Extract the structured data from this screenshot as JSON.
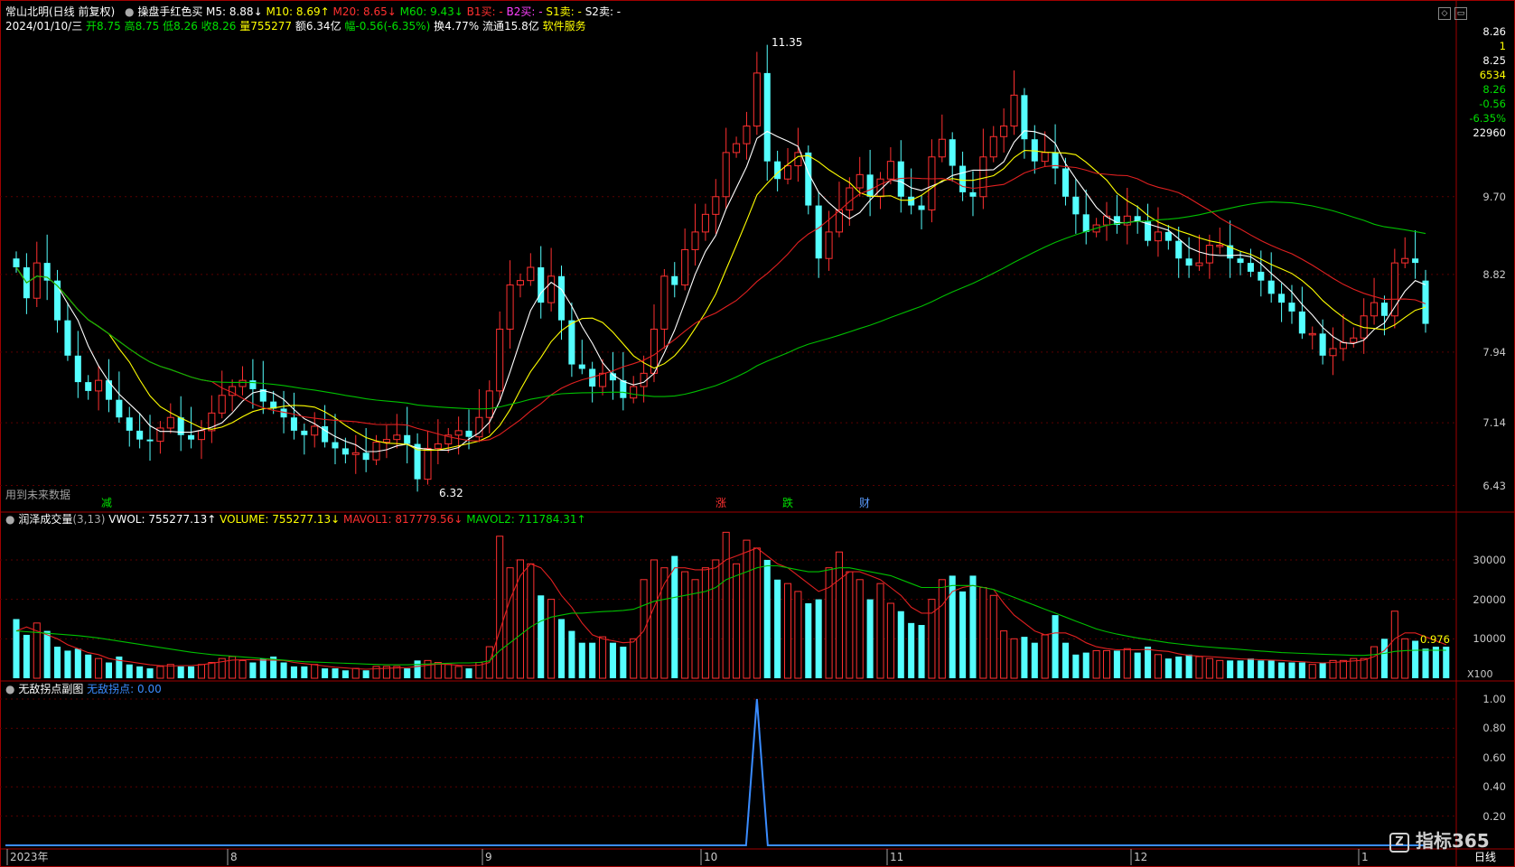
{
  "header": {
    "stock_name": "常山北明(日线 前复权)",
    "indicator_main": "操盘手红色买",
    "ma_values": [
      {
        "label": "M5: 8.88↓",
        "color": "#ffffff"
      },
      {
        "label": "M10: 8.69↑",
        "color": "#ffff00"
      },
      {
        "label": "M20: 8.65↓",
        "color": "#ff3030"
      },
      {
        "label": "M60: 9.43↓",
        "color": "#00e000"
      },
      {
        "label": "B1买: -",
        "color": "#ff3030"
      },
      {
        "label": "B2买: -",
        "color": "#ff40ff"
      },
      {
        "label": "S1卖: -",
        "color": "#ffff00"
      },
      {
        "label": "S2卖: -",
        "color": "#ffffff"
      }
    ],
    "quote_parts": [
      {
        "text": "2024/01/10/三",
        "color": "#ffffff"
      },
      {
        "text": "开8.75",
        "color": "#00e000"
      },
      {
        "text": "高8.75",
        "color": "#00e000"
      },
      {
        "text": "低8.26",
        "color": "#00e000"
      },
      {
        "text": "收8.26",
        "color": "#00e000"
      },
      {
        "text": "量755277",
        "color": "#ffff00"
      },
      {
        "text": "额6.34亿",
        "color": "#ffffff"
      },
      {
        "text": "幅-0.56(-6.35%)",
        "color": "#00e000"
      },
      {
        "text": "换4.77%",
        "color": "#ffffff"
      },
      {
        "text": "流通15.8亿",
        "color": "#ffffff"
      },
      {
        "text": "软件服务",
        "color": "#ffff00"
      }
    ]
  },
  "price_axis": {
    "ticks": [
      "9.70",
      "8.82",
      "7.94",
      "7.14",
      "6.43"
    ],
    "top_info": [
      {
        "text": "8.26",
        "color": "#ffffff"
      },
      {
        "text": "1",
        "color": "#ffff00"
      },
      {
        "text": "8.25",
        "color": "#ffffff"
      },
      {
        "text": "6534",
        "color": "#ffff00"
      },
      {
        "text": "8.26",
        "color": "#00e000"
      },
      {
        "text": "-0.56",
        "color": "#00e000"
      },
      {
        "text": "-6.35%",
        "color": "#00e000"
      },
      {
        "text": "22960",
        "color": "#ffffff"
      }
    ]
  },
  "annotations": {
    "high_label": "11.35",
    "low_label": "6.32",
    "future_data": "用到未来数据",
    "events": [
      {
        "text": "减",
        "color": "#00e000"
      },
      {
        "text": "涨",
        "color": "#ff3030"
      },
      {
        "text": "跌",
        "color": "#00e000"
      },
      {
        "text": "财",
        "color": "#5a9cff"
      }
    ]
  },
  "volume_panel": {
    "title": "润泽成交量",
    "params": "(3,13)",
    "vwol": "VWOL: 755277.13↑",
    "volume": "VOLUME: 755277.13↓",
    "mavol1": "MAVOL1: 817779.56↓",
    "mavol2": "MAVOL2: 711784.31↑",
    "ticks": [
      "30000",
      "20000",
      "10000"
    ],
    "last_value": "0.976",
    "unit": "X100"
  },
  "indicator_panel": {
    "title": "无敌拐点副图",
    "value_label": "无敌拐点: 0.00",
    "ticks": [
      "1.00",
      "0.80",
      "0.60",
      "0.40",
      "0.20"
    ]
  },
  "time_axis": {
    "labels": [
      "2023年",
      "8",
      "9",
      "10",
      "11",
      "12",
      "1"
    ],
    "period": "日线",
    "watermark": "指标365"
  },
  "colors": {
    "up": "#ff3030",
    "down": "#54ffff",
    "ma5": "#ffffff",
    "ma10": "#ffff00",
    "ma20": "#e02020",
    "ma60": "#00c000",
    "grid": "#5a0000",
    "panel_border": "#a00000",
    "indicator": "#3a8cff"
  },
  "chart_data": [
    {
      "type": "candlestick",
      "title": "常山北明(日线 前复权)",
      "price_ticks": [
        9.7,
        8.82,
        7.94,
        7.14,
        6.43
      ],
      "highest": 11.35,
      "lowest": 6.32,
      "last": {
        "date": "2024/01/10",
        "open": 8.75,
        "high": 8.75,
        "low": 8.26,
        "close": 8.26
      },
      "close": [
        8.9,
        8.55,
        8.95,
        8.75,
        8.3,
        7.9,
        7.6,
        7.5,
        7.62,
        7.4,
        7.2,
        7.05,
        6.95,
        6.93,
        7.08,
        7.2,
        7.0,
        6.95,
        7.05,
        7.25,
        7.45,
        7.55,
        7.62,
        7.52,
        7.38,
        7.3,
        7.2,
        7.05,
        7.0,
        7.1,
        6.92,
        6.85,
        6.78,
        6.8,
        6.72,
        6.92,
        6.95,
        7.0,
        6.9,
        6.5,
        6.85,
        6.9,
        7.0,
        7.05,
        6.98,
        7.2,
        7.5,
        8.2,
        8.7,
        8.75,
        8.9,
        8.5,
        8.8,
        8.3,
        7.8,
        7.75,
        7.55,
        7.7,
        7.62,
        7.42,
        7.55,
        7.7,
        8.2,
        8.8,
        8.7,
        9.1,
        9.3,
        9.5,
        9.7,
        10.2,
        10.3,
        10.5,
        11.1,
        10.1,
        9.9,
        10.05,
        10.2,
        9.6,
        9.0,
        9.3,
        9.55,
        9.8,
        9.95,
        9.7,
        9.9,
        10.1,
        9.7,
        9.6,
        9.55,
        10.15,
        10.35,
        10.05,
        9.75,
        9.7,
        10.15,
        10.38,
        10.5,
        10.85,
        10.35,
        10.1,
        10.2,
        10.02,
        9.7,
        9.5,
        9.3,
        9.38,
        9.48,
        9.38,
        9.48,
        9.42,
        9.2,
        9.3,
        9.2,
        9.0,
        8.92,
        8.95,
        9.15,
        9.15,
        9.0,
        8.95,
        8.85,
        8.75,
        8.6,
        8.5,
        8.4,
        8.15,
        8.15,
        7.9,
        7.98,
        8.05,
        8.1,
        8.35,
        8.5,
        8.35,
        8.95,
        9.0,
        8.95,
        8.26
      ]
    },
    {
      "type": "bar",
      "title": "润泽成交量",
      "series": [
        {
          "name": "VOLUME",
          "values": [
            15000,
            11000,
            14000,
            12000,
            8000,
            7000,
            7500,
            6000,
            5000,
            4000,
            5500,
            3500,
            3000,
            2500,
            3000,
            3500,
            3000,
            3000,
            3500,
            4000,
            5000,
            5500,
            4500,
            4000,
            5000,
            5500,
            4000,
            3000,
            3000,
            3500,
            2500,
            2500,
            2000,
            2500,
            2000,
            3000,
            3000,
            3000,
            2500,
            4500,
            4500,
            4000,
            3500,
            3000,
            2500,
            4000,
            8000,
            36000,
            28000,
            30000,
            29000,
            21000,
            20000,
            15000,
            12000,
            9000,
            9000,
            10500,
            9000,
            8000,
            10000,
            25000,
            30000,
            28000,
            31000,
            27000,
            25000,
            28000,
            30000,
            37000,
            29000,
            35000,
            33000,
            30000,
            25000,
            24000,
            22000,
            19000,
            20000,
            28000,
            32000,
            27000,
            25000,
            20000,
            24000,
            19000,
            17000,
            14000,
            13500,
            20000,
            25000,
            26000,
            22000,
            26000,
            23000,
            21000,
            12000,
            10000,
            10500,
            9000,
            11000,
            16000,
            9000,
            6000,
            6500,
            7000,
            7000,
            7000,
            7500,
            6500,
            8000,
            6000,
            5000,
            5500,
            6000,
            5500,
            5000,
            4500,
            4500,
            4500,
            5000,
            4500,
            4500,
            4000,
            4000,
            4000,
            3500,
            4000,
            4500,
            4500,
            5000,
            5000,
            8000,
            10000,
            17000,
            10000,
            9500,
            7500,
            8000,
            8000
          ]
        },
        {
          "name": "MAVOL1",
          "values": [
            12000,
            13000,
            12000,
            11000,
            10000,
            8500,
            7500,
            6500,
            6000,
            5000,
            4500,
            4200,
            3800,
            3400,
            3200,
            3100,
            3200,
            3200,
            3400,
            3800,
            4200,
            4600,
            4700,
            4700,
            4600,
            4600,
            4500,
            4000,
            3700,
            3400,
            3100,
            2800,
            2600,
            2400,
            2300,
            2400,
            2500,
            2600,
            2700,
            3000,
            3300,
            3600,
            3500,
            3300,
            3200,
            3300,
            4000,
            12000,
            20000,
            26000,
            29000,
            28000,
            25000,
            21000,
            18000,
            14000,
            11000,
            10000,
            9500,
            9000,
            9200,
            12000,
            18000,
            24000,
            28000,
            28000,
            27500,
            27500,
            28000,
            30000,
            31000,
            32000,
            33000,
            31000,
            29000,
            28000,
            26000,
            24000,
            22000,
            23000,
            25000,
            27000,
            27000,
            26000,
            25000,
            23000,
            21000,
            18000,
            16500,
            16500,
            18500,
            22000,
            23000,
            23500,
            23000,
            22500,
            19000,
            16000,
            14000,
            12000,
            11000,
            11500,
            11500,
            10500,
            9000,
            8000,
            7500,
            7200,
            7200,
            7200,
            7300,
            7000,
            6800,
            6200,
            5800,
            5600,
            5500,
            5300,
            5100,
            4900,
            4800,
            4700,
            4600,
            4500,
            4300,
            4200,
            4000,
            3900,
            4000,
            4200,
            4400,
            4600,
            5500,
            7000,
            10000,
            11500,
            11500,
            10500,
            9500,
            8500
          ]
        },
        {
          "name": "MAVOL2",
          "values": [
            12000,
            11800,
            11600,
            11400,
            11200,
            11000,
            10800,
            10500,
            10200,
            9800,
            9400,
            9000,
            8600,
            8200,
            7800,
            7400,
            7000,
            6600,
            6300,
            6000,
            5800,
            5600,
            5400,
            5200,
            5000,
            4800,
            4600,
            4400,
            4200,
            4100,
            4000,
            3900,
            3800,
            3700,
            3600,
            3500,
            3400,
            3400,
            3400,
            3500,
            3600,
            3700,
            3800,
            3900,
            3900,
            4000,
            4400,
            7000,
            9000,
            11000,
            13000,
            14500,
            15500,
            16000,
            16500,
            16500,
            16700,
            16900,
            17000,
            17200,
            17500,
            18500,
            19500,
            20000,
            20500,
            21000,
            21500,
            22000,
            23000,
            25000,
            26000,
            27000,
            28000,
            28500,
            28500,
            28000,
            27500,
            27000,
            27000,
            27500,
            28000,
            28000,
            27500,
            27000,
            26500,
            26000,
            25000,
            24000,
            23000,
            23000,
            23000,
            23500,
            23500,
            23500,
            23000,
            22500,
            21500,
            20500,
            19500,
            18500,
            17500,
            16500,
            15500,
            14500,
            13500,
            12500,
            11800,
            11200,
            10700,
            10200,
            9800,
            9400,
            9000,
            8700,
            8400,
            8100,
            7900,
            7700,
            7500,
            7300,
            7100,
            6900,
            6700,
            6500,
            6400,
            6300,
            6200,
            6100,
            6000,
            5900,
            5800,
            5800,
            6000,
            6300,
            6800,
            7000,
            7100,
            7100,
            7100,
            7100
          ]
        }
      ]
    },
    {
      "type": "line",
      "title": "无敌拐点副图",
      "series": [
        {
          "name": "无敌拐点",
          "spike_index": 72,
          "peak": 1.0,
          "baseline": 0.0
        }
      ]
    }
  ]
}
